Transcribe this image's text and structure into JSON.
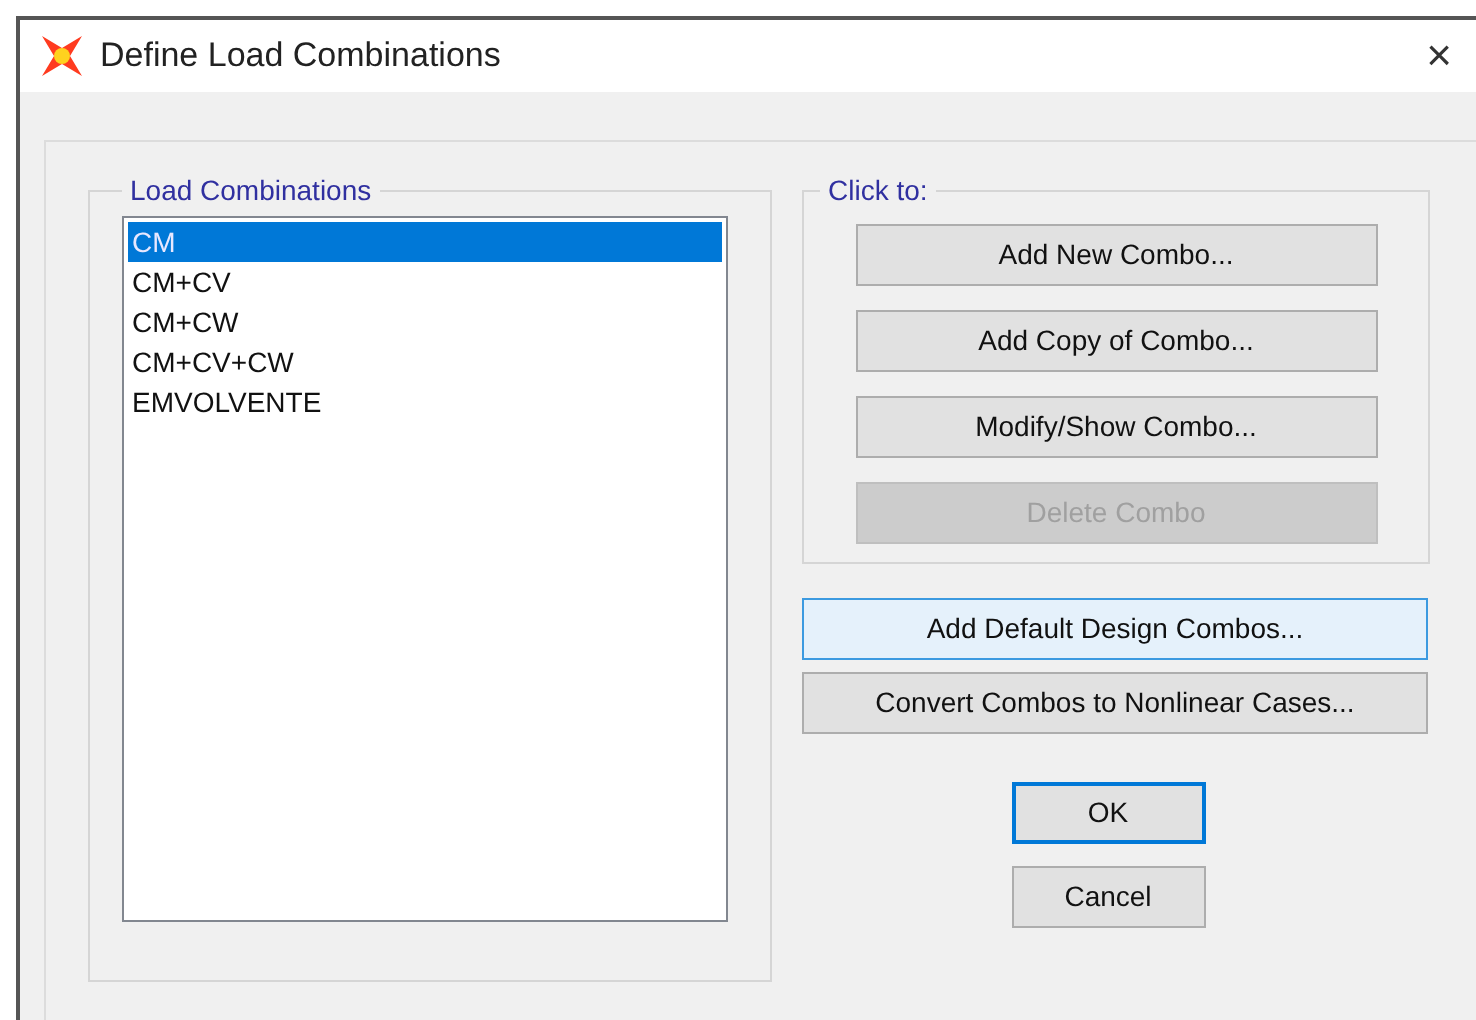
{
  "window": {
    "title": "Define Load Combinations",
    "close": "×"
  },
  "load_combinations": {
    "legend": "Load Combinations",
    "items": [
      {
        "label": "CM",
        "selected": true
      },
      {
        "label": "CM+CV",
        "selected": false
      },
      {
        "label": "CM+CW",
        "selected": false
      },
      {
        "label": "CM+CV+CW",
        "selected": false
      },
      {
        "label": "EMVOLVENTE",
        "selected": false
      }
    ]
  },
  "click_to": {
    "legend": "Click to:",
    "buttons": [
      {
        "label": "Add New Combo...",
        "kind": "normal"
      },
      {
        "label": "Add Copy of Combo...",
        "kind": "normal"
      },
      {
        "label": "Modify/Show Combo...",
        "kind": "normal"
      },
      {
        "label": "Delete Combo",
        "kind": "disabled"
      }
    ]
  },
  "extra_buttons": [
    {
      "label": "Add Default Design Combos...",
      "kind": "hover"
    },
    {
      "label": "Convert Combos to Nonlinear Cases...",
      "kind": "normal"
    }
  ],
  "dialog_buttons": [
    {
      "label": "OK",
      "kind": "default"
    },
    {
      "label": "Cancel",
      "kind": "normal"
    }
  ]
}
